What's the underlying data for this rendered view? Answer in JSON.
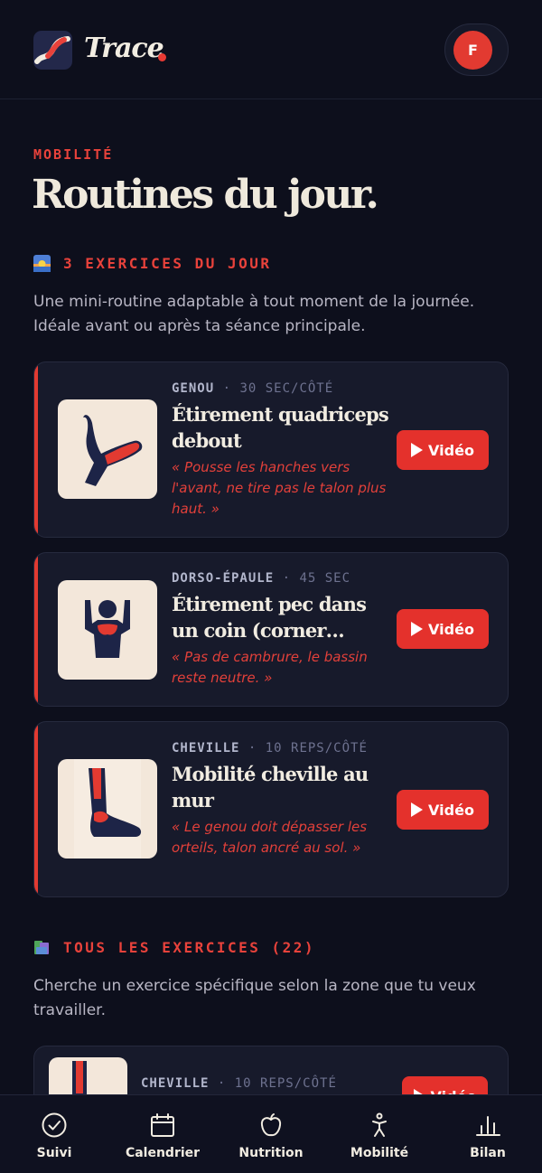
{
  "header": {
    "brand": "Trace",
    "avatar_initial": "F"
  },
  "page": {
    "eyebrow": "MOBILITÉ",
    "title": "Routines du jour."
  },
  "daily": {
    "label": "3 EXERCICES DU JOUR",
    "intro": "Une mini-routine adaptable à tout moment de la journée. Idéale avant ou après ta séance principale.",
    "exercises": [
      {
        "zone": "GENOU",
        "duration": "30 SEC/CÔTÉ",
        "title": "Étirement quadriceps debout",
        "tip": "« Pousse les hanches vers l'avant, ne tire pas le talon plus haut. »",
        "video_label": "Vidéo"
      },
      {
        "zone": "DORSO-ÉPAULE",
        "duration": "45 SEC",
        "title": "Étirement pec dans un coin (corner…",
        "tip": "« Pas de cambrure, le bassin reste neutre. »",
        "video_label": "Vidéo"
      },
      {
        "zone": "CHEVILLE",
        "duration": "10 REPS/CÔTÉ",
        "title": "Mobilité cheville au mur",
        "tip": "« Le genou doit dépasser les orteils, talon ancré au sol. »",
        "video_label": "Vidéo"
      }
    ]
  },
  "all": {
    "label": "TOUS LES EXERCICES (22)",
    "intro": "Cherche un exercice spécifique selon la zone que tu veux travailler.",
    "first": {
      "zone": "CHEVILLE",
      "duration": "10 REPS/CÔTÉ",
      "video_label": "Vidéo"
    }
  },
  "nav": [
    {
      "label": "Suivi",
      "icon": "check-circle-icon"
    },
    {
      "label": "Calendrier",
      "icon": "calendar-icon"
    },
    {
      "label": "Nutrition",
      "icon": "apple-icon"
    },
    {
      "label": "Mobilité",
      "icon": "person-stretch-icon"
    },
    {
      "label": "Bilan",
      "icon": "bar-chart-icon"
    }
  ],
  "colors": {
    "background": "#0d0f1c",
    "card": "#171a2b",
    "accent": "#e4312c",
    "text": "#efe9dc"
  }
}
